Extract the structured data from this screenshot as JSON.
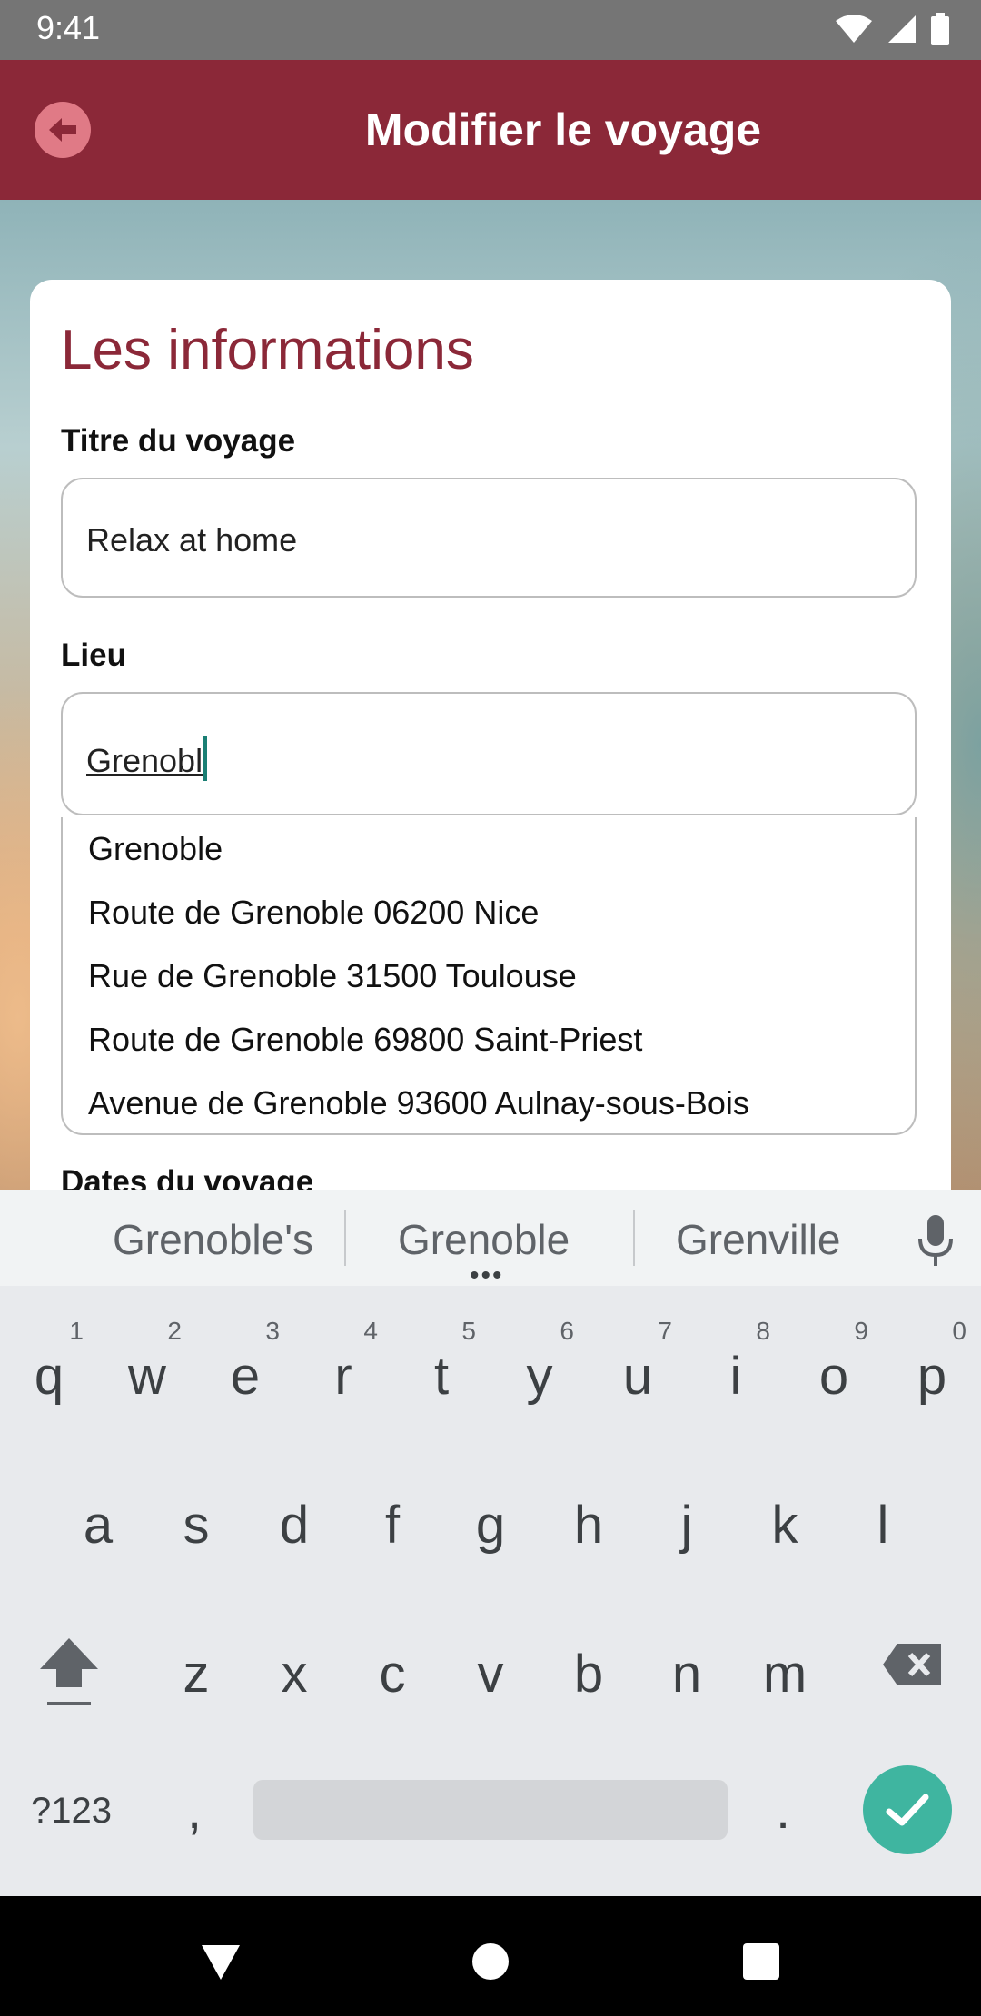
{
  "status_bar": {
    "time": "9:41"
  },
  "app_bar": {
    "title": "Modifier le voyage"
  },
  "card": {
    "heading": "Les informations",
    "title_field": {
      "label": "Titre du voyage",
      "value": "Relax at home"
    },
    "place_field": {
      "label": "Lieu",
      "value": "Grenobl"
    },
    "suggestions": [
      "Grenoble",
      "Route de Grenoble 06200 Nice",
      "Rue de Grenoble 31500 Toulouse",
      "Route de Grenoble 69800 Saint-Priest",
      "Avenue de Grenoble 93600 Aulnay-sous-Bois"
    ],
    "next_label": "Dates du voyage"
  },
  "keyboard": {
    "suggestions": [
      "Grenoble's",
      "Grenoble",
      "Grenville"
    ],
    "row1": [
      {
        "ch": "q",
        "num": "1"
      },
      {
        "ch": "w",
        "num": "2"
      },
      {
        "ch": "e",
        "num": "3"
      },
      {
        "ch": "r",
        "num": "4"
      },
      {
        "ch": "t",
        "num": "5"
      },
      {
        "ch": "y",
        "num": "6"
      },
      {
        "ch": "u",
        "num": "7"
      },
      {
        "ch": "i",
        "num": "8"
      },
      {
        "ch": "o",
        "num": "9"
      },
      {
        "ch": "p",
        "num": "0"
      }
    ],
    "row2": [
      "a",
      "s",
      "d",
      "f",
      "g",
      "h",
      "j",
      "k",
      "l"
    ],
    "row3": [
      "z",
      "x",
      "c",
      "v",
      "b",
      "n",
      "m"
    ],
    "symbols_label": "?123",
    "comma": ",",
    "period": "."
  },
  "colors": {
    "primary": "#8b2838",
    "accent": "#3fb5a0"
  },
  "icons": {
    "back": "arrow-left-icon",
    "mic": "mic-icon",
    "shift": "shift-icon",
    "backspace": "backspace-icon",
    "enter": "check-icon",
    "wifi": "wifi-icon",
    "signal": "signal-icon",
    "battery": "battery-icon"
  }
}
